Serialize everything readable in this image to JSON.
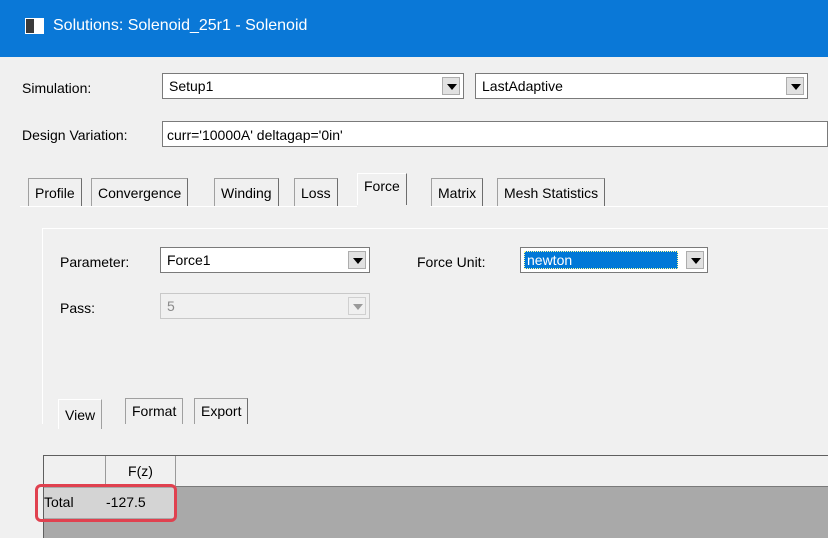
{
  "window": {
    "title": "Solutions: Solenoid_25r1 - Solenoid"
  },
  "simulation": {
    "label": "Simulation:",
    "setup_value": "Setup1",
    "solution_value": "LastAdaptive"
  },
  "design_variation": {
    "label": "Design Variation:",
    "value": "curr='10000A' deltagap='0in'"
  },
  "tabs": [
    {
      "label": "Profile"
    },
    {
      "label": "Convergence"
    },
    {
      "label": "Winding"
    },
    {
      "label": "Loss"
    },
    {
      "label": "Force",
      "active": true
    },
    {
      "label": "Matrix"
    },
    {
      "label": "Mesh Statistics"
    }
  ],
  "force_panel": {
    "parameter_label": "Parameter:",
    "parameter_value": "Force1",
    "force_unit_label": "Force Unit:",
    "force_unit_value": "newton",
    "pass_label": "Pass:",
    "pass_value": "5"
  },
  "subtabs": [
    {
      "label": "View",
      "active": true
    },
    {
      "label": "Format"
    },
    {
      "label": "Export"
    }
  ],
  "results_table": {
    "columns": [
      "",
      "F(z)"
    ],
    "rows": [
      {
        "label": "Total",
        "fz": "-127.5"
      }
    ]
  },
  "colors": {
    "titlebar": "#0a78d7",
    "selection": "#0078d7",
    "highlight_border": "#e0414f"
  }
}
